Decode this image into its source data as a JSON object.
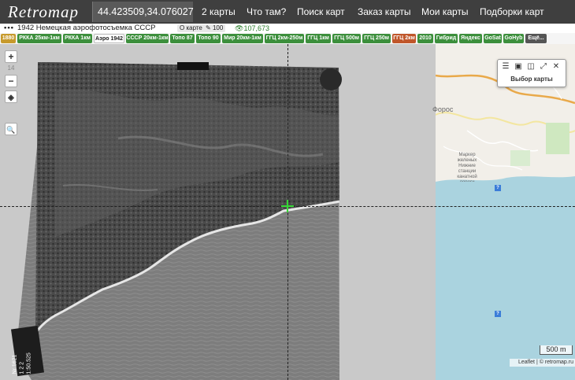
{
  "topbar": {
    "logo": "Retromap",
    "coordinates": "44.423509,34.076027",
    "nav": [
      "2 карты",
      "Что там?",
      "Поиск карт",
      "Заказ карты",
      "Мои карты",
      "Подборки карт"
    ]
  },
  "infobar": {
    "title": "1942 Немецкая аэрофотосъемка СССР",
    "about_map": "О карте",
    "edit_count": "100",
    "views": "107,673"
  },
  "tabs": [
    {
      "label": "1880",
      "color": "#c79a2c"
    },
    {
      "label": "РККА 25км-1км",
      "color": "#3c8f3c"
    },
    {
      "label": "РККА 1км",
      "color": "#3c8f3c"
    },
    {
      "label": "Аэро 1942",
      "color": "#ffffff"
    },
    {
      "label": "СССР 20км-1км",
      "color": "#3c8f3c"
    },
    {
      "label": "Топо 87",
      "color": "#3c8f3c"
    },
    {
      "label": "Топо 90",
      "color": "#3c8f3c"
    },
    {
      "label": "Мир 20км-1км",
      "color": "#3c8f3c"
    },
    {
      "label": "ГГЦ 2км-250м",
      "color": "#3c8f3c"
    },
    {
      "label": "ГГЦ 1км",
      "color": "#3c8f3c"
    },
    {
      "label": "ГГЦ 500м",
      "color": "#3c8f3c"
    },
    {
      "label": "ГГЦ 250м",
      "color": "#3c8f3c"
    },
    {
      "label": "ГГЦ 2км",
      "color": "#c0562a"
    },
    {
      "label": "2010",
      "color": "#3c8f3c"
    },
    {
      "label": "Гибрид",
      "color": "#3c8f3c"
    },
    {
      "label": "Яндекс",
      "color": "#3c8f3c"
    },
    {
      "label": "GoSat",
      "color": "#3c8f3c"
    },
    {
      "label": "GoHyb",
      "color": "#3c8f3c"
    },
    {
      "label": "Ещё...",
      "color": "#555555"
    }
  ],
  "controls": {
    "zoom_in": "+",
    "zoom_level": "14",
    "zoom_out": "−"
  },
  "panel": {
    "label": "Выбор карты"
  },
  "map": {
    "place_label": "Форос",
    "sea_label": "Маркер\nжеленых\nНижние\nстанции\nканатной\nдороги\nанатория\n\"Ясный\"",
    "scale": "500 m",
    "attribution": "Leaflet | © retromap.ru",
    "photo_corner_text": "Nr 1621\n1 2 2\n1:50.525"
  },
  "colors": {
    "topbar": "#3f3f3f",
    "accent_green": "#3c8f3c",
    "sea": "#aad3df"
  }
}
